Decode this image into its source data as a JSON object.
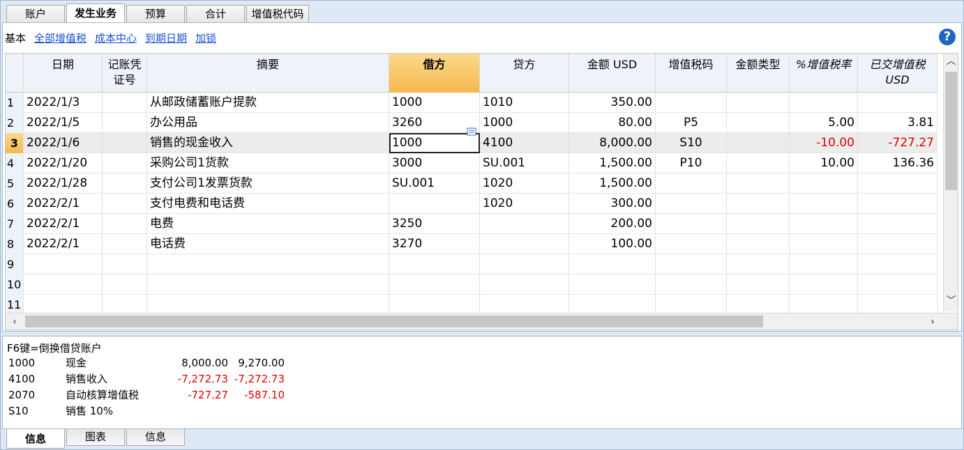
{
  "top_tabs": [
    {
      "label": "账户",
      "active": false
    },
    {
      "label": "发生业务",
      "active": true
    },
    {
      "label": "预算",
      "active": false
    },
    {
      "label": "合计",
      "active": false
    },
    {
      "label": "增值税代码",
      "active": false
    }
  ],
  "views": {
    "base": "基本",
    "links": [
      "全部增值税",
      "成本中心",
      "到期日期",
      "加锁"
    ]
  },
  "help_icon": "?",
  "columns": [
    {
      "label": "日期",
      "italic": false,
      "selected": false
    },
    {
      "label": "记账凭证号",
      "italic": false,
      "selected": false
    },
    {
      "label": "摘要",
      "italic": false,
      "selected": false
    },
    {
      "label": "借方",
      "italic": false,
      "selected": true
    },
    {
      "label": "贷方",
      "italic": false,
      "selected": false
    },
    {
      "label": "金额 USD",
      "italic": false,
      "selected": false
    },
    {
      "label": "增值税码",
      "italic": false,
      "selected": false
    },
    {
      "label": "金额类型",
      "italic": false,
      "selected": false
    },
    {
      "label": "%增值税率",
      "italic": true,
      "selected": false
    },
    {
      "label": "已交增值税USD",
      "italic": true,
      "selected": false
    }
  ],
  "rows": [
    {
      "n": "1",
      "date": "2022/1/3",
      "doc": "",
      "desc": "从邮政储蓄账户提款",
      "debit": "1000",
      "credit": "1010",
      "amount": "350.00",
      "vat": "",
      "type": "",
      "rate": "",
      "vatusd": ""
    },
    {
      "n": "2",
      "date": "2022/1/5",
      "doc": "",
      "desc": "办公用品",
      "debit": "3260",
      "credit": "1000",
      "amount": "80.00",
      "vat": "P5",
      "type": "",
      "rate": "5.00",
      "vatusd": "3.81"
    },
    {
      "n": "3",
      "date": "2022/1/6",
      "doc": "",
      "desc": "销售的现金收入",
      "debit": "1000",
      "credit": "4100",
      "amount": "8,000.00",
      "vat": "S10",
      "type": "",
      "rate": "-10.00",
      "vatusd": "-727.27"
    },
    {
      "n": "4",
      "date": "2022/1/20",
      "doc": "",
      "desc": "采购公司1货款",
      "debit": "3000",
      "credit": "SU.001",
      "amount": "1,500.00",
      "vat": "P10",
      "type": "",
      "rate": "10.00",
      "vatusd": "136.36"
    },
    {
      "n": "5",
      "date": "2022/1/28",
      "doc": "",
      "desc": "支付公司1发票货款",
      "debit": "SU.001",
      "credit": "1020",
      "amount": "1,500.00",
      "vat": "",
      "type": "",
      "rate": "",
      "vatusd": ""
    },
    {
      "n": "6",
      "date": "2022/2/1",
      "doc": "",
      "desc": "支付电费和电话费",
      "debit": "",
      "credit": "1020",
      "amount": "300.00",
      "vat": "",
      "type": "",
      "rate": "",
      "vatusd": ""
    },
    {
      "n": "7",
      "date": "2022/2/1",
      "doc": "",
      "desc": "电费",
      "debit": "3250",
      "credit": "",
      "amount": "200.00",
      "vat": "",
      "type": "",
      "rate": "",
      "vatusd": ""
    },
    {
      "n": "8",
      "date": "2022/2/1",
      "doc": "",
      "desc": "电话费",
      "debit": "3270",
      "credit": "",
      "amount": "100.00",
      "vat": "",
      "type": "",
      "rate": "",
      "vatusd": ""
    },
    {
      "n": "9",
      "date": "",
      "doc": "",
      "desc": "",
      "debit": "",
      "credit": "",
      "amount": "",
      "vat": "",
      "type": "",
      "rate": "",
      "vatusd": ""
    },
    {
      "n": "10",
      "date": "",
      "doc": "",
      "desc": "",
      "debit": "",
      "credit": "",
      "amount": "",
      "vat": "",
      "type": "",
      "rate": "",
      "vatusd": ""
    },
    {
      "n": "11",
      "date": "",
      "doc": "",
      "desc": "",
      "debit": "",
      "credit": "",
      "amount": "",
      "vat": "",
      "type": "",
      "rate": "",
      "vatusd": ""
    }
  ],
  "current_row": "3",
  "info": {
    "title": "F6键=倒换借贷账户",
    "lines": [
      {
        "code": "1000",
        "name": "现金",
        "v1": "8,000.00",
        "v2": "9,270.00"
      },
      {
        "code": "4100",
        "name": "销售收入",
        "v1": "-7,272.73",
        "v2": "-7,272.73"
      },
      {
        "code": "2070",
        "name": "自动核算增值税",
        "v1": "-727.27",
        "v2": "-587.10"
      },
      {
        "code": "S10",
        "name": "销售 10%",
        "v1": "",
        "v2": ""
      }
    ]
  },
  "bottom_tabs": [
    {
      "label": "信息",
      "active": true
    },
    {
      "label": "图表",
      "active": false
    },
    {
      "label": "信息",
      "active": false
    }
  ],
  "colors": {
    "accent": "#f5b84e",
    "negative": "#e00000",
    "link": "#1a4fd6",
    "frame": "#dfe9f5"
  }
}
